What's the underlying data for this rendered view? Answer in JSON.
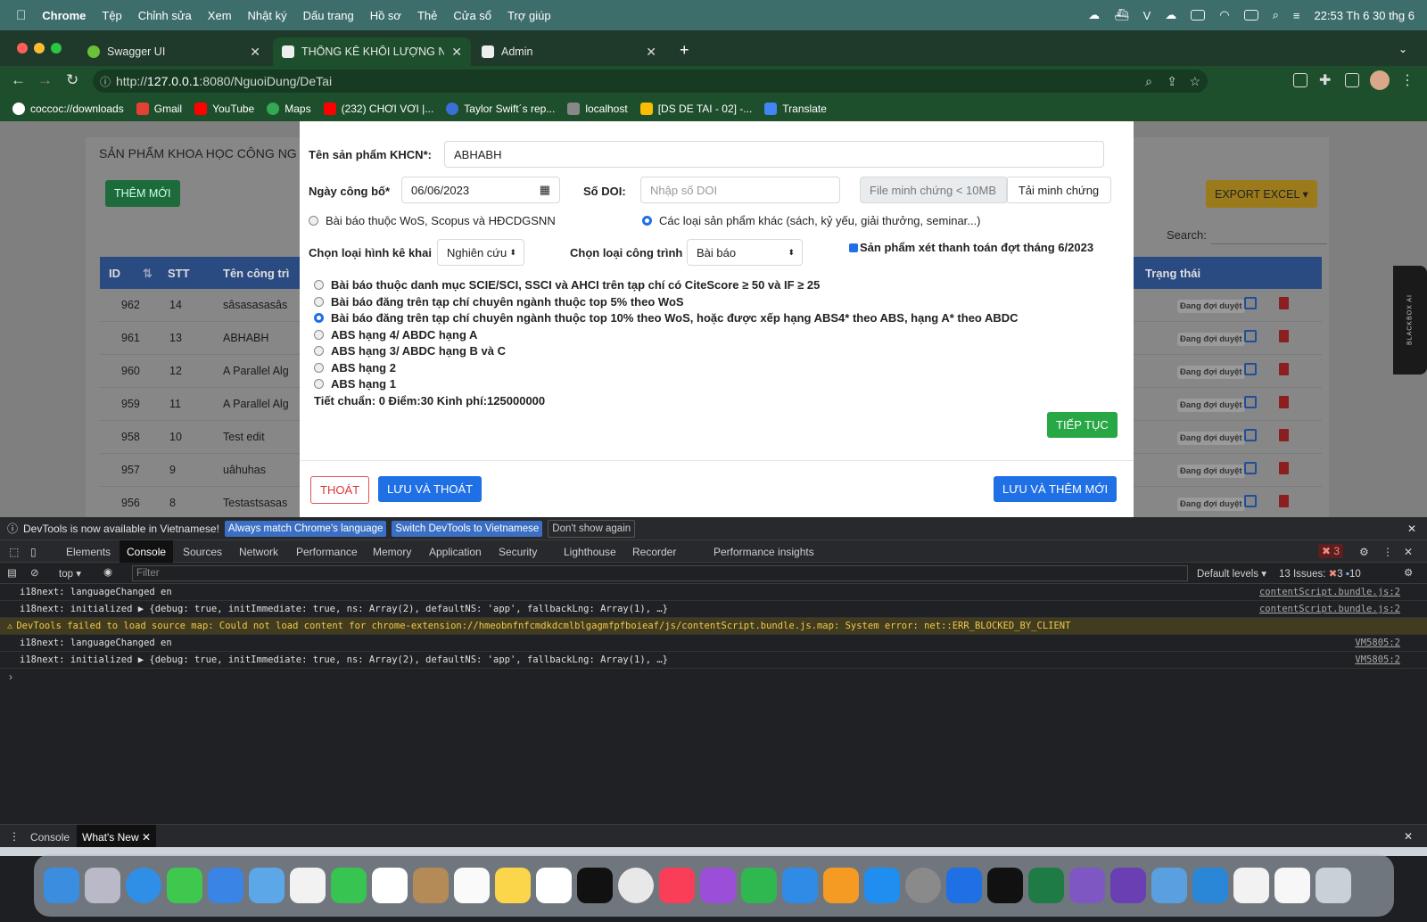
{
  "menubar": {
    "app": "Chrome",
    "items": [
      "Tệp",
      "Chỉnh sửa",
      "Xem",
      "Nhật ký",
      "Dấu trang",
      "Hồ sơ",
      "Thẻ",
      "Cửa sổ",
      "Trợ giúp"
    ],
    "clock": "22:53 Th 6 30 thg 6"
  },
  "tabs": [
    {
      "title": "Swagger UI",
      "active": false
    },
    {
      "title": "THỐNG KÊ KHỐI LƯỢNG NCK",
      "active": true
    },
    {
      "title": "Admin",
      "active": false
    }
  ],
  "address": {
    "scheme": "http://",
    "host": "127.0.0.1",
    "path": ":8080/NguoiDung/DeTai"
  },
  "bookmarks": [
    "coccoc://downloads",
    "Gmail",
    "YouTube",
    "Maps",
    "(232) CHƠI VƠI |...",
    "Taylor Swift´s rep...",
    "localhost",
    "[DS DE TAI - 02] -...",
    "Translate"
  ],
  "background_page": {
    "title": "SẢN PHẨM KHOA HỌC CÔNG NG",
    "add_button": "THÊM MỚI",
    "export_button": "EXPORT EXCEL",
    "search_label": "Search:",
    "columns": {
      "id": "ID",
      "stt": "STT",
      "name": "Tên công trì",
      "status": "Trạng thái"
    },
    "rows": [
      {
        "id": "962",
        "stt": "14",
        "name": "sâsasasasâs",
        "status": "Đang đợi duyệt"
      },
      {
        "id": "961",
        "stt": "13",
        "name": "ABHABH",
        "status": "Đang đợi duyệt"
      },
      {
        "id": "960",
        "stt": "12",
        "name": "A Parallel Alg",
        "status": "Đang đợi duyệt"
      },
      {
        "id": "959",
        "stt": "11",
        "name": "A Parallel Alg",
        "status": "Đang đợi duyệt"
      },
      {
        "id": "958",
        "stt": "10",
        "name": "Test edit",
        "status": "Đang đợi duyệt"
      },
      {
        "id": "957",
        "stt": "9",
        "name": "uâhuhas",
        "status": "Đang đợi duyệt"
      },
      {
        "id": "956",
        "stt": "8",
        "name": "Testastsasas",
        "status": "Đang đợi duyệt"
      }
    ]
  },
  "modal": {
    "product_name_label": "Tên sản phẩm KHCN*:",
    "product_name_value": "ABHABH",
    "date_label": "Ngày công bố*",
    "date_value": "06/06/2023",
    "doi_label": "Số DOI:",
    "doi_placeholder": "Nhập số DOI",
    "file_placeholder": "File minh chứng < 10MB",
    "upload_button": "Tải minh chứng",
    "type_option_1": "Bài báo thuộc WoS, Scopus và HĐCDGSNN",
    "type_option_2": "Các loại sản phẩm khác (sách, kỷ yếu, giải thưởng, seminar...)",
    "deploy_label": "Chọn loại hình kê khai",
    "deploy_value": "Nghiên cứu",
    "work_label": "Chọn loại công trình",
    "work_value": "Bài báo",
    "payment_check": "Sản phẩm xét thanh toán đợt tháng 6/2023",
    "categories": [
      {
        "label": "Bài báo thuộc danh mục SCIE/SCI, SSCI và AHCI trên tạp chí có CiteScore ≥ 50 và IF ≥ 25",
        "selected": false
      },
      {
        "label": "Bài báo đăng trên tạp chí chuyên ngành thuộc top 5% theo WoS",
        "selected": false
      },
      {
        "label": "Bài báo đăng trên tạp chí chuyên ngành thuộc top 10% theo WoS, hoặc được xếp hạng ABS4* theo ABS, hạng A* theo ABDC",
        "selected": true
      },
      {
        "label": "ABS hạng 4/ ABDC hạng A",
        "selected": false
      },
      {
        "label": "ABS hạng 3/ ABDC hạng B và C",
        "selected": false
      },
      {
        "label": "ABS hạng 2",
        "selected": false
      },
      {
        "label": "ABS hạng 1",
        "selected": false
      }
    ],
    "summary": "Tiết chuẩn: 0 Điểm:30 Kinh phí:125000000",
    "continue_button": "TIẾP TỤC",
    "exit_button": "THOÁT",
    "save_exit_button": "LƯU VÀ THOÁT",
    "save_new_button": "LƯU VÀ THÊM MỚI"
  },
  "side_widget": "BLACKBOX AI",
  "devtools": {
    "banner_text": "DevTools is now available in Vietnamese!",
    "banner_btn1": "Always match Chrome's language",
    "banner_btn2": "Switch DevTools to Vietnamese",
    "banner_btn3": "Don't show again",
    "tabs": [
      "Elements",
      "Console",
      "Sources",
      "Network",
      "Performance",
      "Memory",
      "Application",
      "Security",
      "Lighthouse",
      "Recorder",
      "Performance insights"
    ],
    "active_tab": "Console",
    "errors_count": "3",
    "context": "top",
    "filter_placeholder": "Filter",
    "levels": "Default levels",
    "issues_label": "13 Issues:",
    "issues_errors": "3",
    "issues_info": "10",
    "logs": [
      {
        "text": "i18next: languageChanged en",
        "src": "contentScript.bundle.js:2",
        "warn": false
      },
      {
        "text": "i18next: initialized  ▶ {debug: true, initImmediate: true, ns: Array(2), defaultNS: 'app', fallbackLng: Array(1), …}",
        "src": "contentScript.bundle.js:2",
        "warn": false
      },
      {
        "text": "DevTools failed to load source map: Could not load content for chrome-extension://hmeobnfnfcmdkdcmlblgagmfpfboieaf/js/contentScript.bundle.js.map: System error: net::ERR_BLOCKED_BY_CLIENT",
        "src": "",
        "warn": true
      },
      {
        "text": "i18next: languageChanged en",
        "src": "VM5805:2",
        "warn": false
      },
      {
        "text": "i18next: initialized  ▶ {debug: true, initImmediate: true, ns: Array(2), defaultNS: 'app', fallbackLng: Array(1), …}",
        "src": "VM5805:2",
        "warn": false
      }
    ],
    "drawer_tabs": [
      "Console",
      "What's New"
    ]
  }
}
